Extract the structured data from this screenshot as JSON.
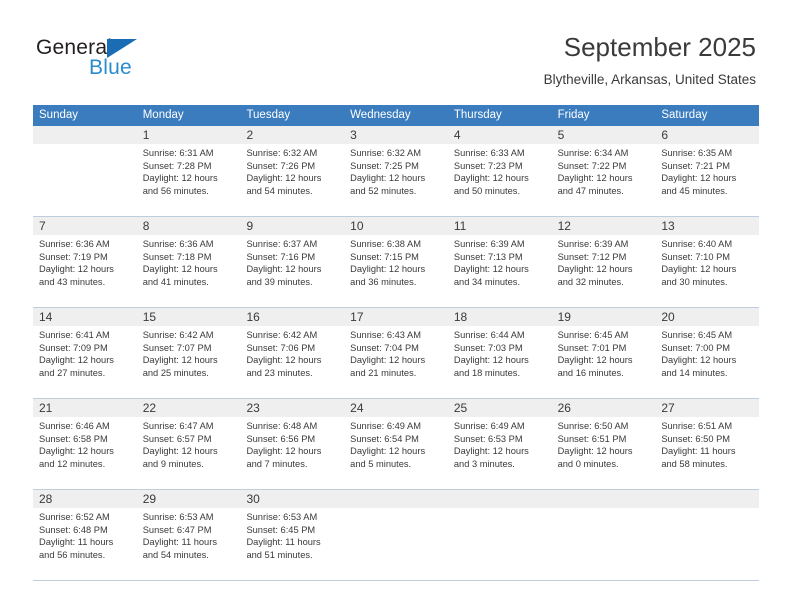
{
  "brand": {
    "name_part1": "General",
    "name_part2": "Blue",
    "triangle_icon": "triangle-icon",
    "colors": {
      "dark": "#231f20",
      "blue": "#2b8ccc",
      "triangle": "#1a6db5"
    }
  },
  "header": {
    "title": "September 2025",
    "subtitle": "Blytheville, Arkansas, United States"
  },
  "theme": {
    "header_row_bg": "#3a7cbe",
    "day_number_band_bg": "#efefef",
    "separator": "#bfcedd",
    "text": "#3a3a3a"
  },
  "weekdays": [
    "Sunday",
    "Monday",
    "Tuesday",
    "Wednesday",
    "Thursday",
    "Friday",
    "Saturday"
  ],
  "weeks": [
    [
      {
        "day": "",
        "sunrise": "",
        "sunset": "",
        "daylight_line1": "",
        "daylight_line2": ""
      },
      {
        "day": "1",
        "sunrise": "Sunrise: 6:31 AM",
        "sunset": "Sunset: 7:28 PM",
        "daylight_line1": "Daylight: 12 hours",
        "daylight_line2": "and 56 minutes."
      },
      {
        "day": "2",
        "sunrise": "Sunrise: 6:32 AM",
        "sunset": "Sunset: 7:26 PM",
        "daylight_line1": "Daylight: 12 hours",
        "daylight_line2": "and 54 minutes."
      },
      {
        "day": "3",
        "sunrise": "Sunrise: 6:32 AM",
        "sunset": "Sunset: 7:25 PM",
        "daylight_line1": "Daylight: 12 hours",
        "daylight_line2": "and 52 minutes."
      },
      {
        "day": "4",
        "sunrise": "Sunrise: 6:33 AM",
        "sunset": "Sunset: 7:23 PM",
        "daylight_line1": "Daylight: 12 hours",
        "daylight_line2": "and 50 minutes."
      },
      {
        "day": "5",
        "sunrise": "Sunrise: 6:34 AM",
        "sunset": "Sunset: 7:22 PM",
        "daylight_line1": "Daylight: 12 hours",
        "daylight_line2": "and 47 minutes."
      },
      {
        "day": "6",
        "sunrise": "Sunrise: 6:35 AM",
        "sunset": "Sunset: 7:21 PM",
        "daylight_line1": "Daylight: 12 hours",
        "daylight_line2": "and 45 minutes."
      }
    ],
    [
      {
        "day": "7",
        "sunrise": "Sunrise: 6:36 AM",
        "sunset": "Sunset: 7:19 PM",
        "daylight_line1": "Daylight: 12 hours",
        "daylight_line2": "and 43 minutes."
      },
      {
        "day": "8",
        "sunrise": "Sunrise: 6:36 AM",
        "sunset": "Sunset: 7:18 PM",
        "daylight_line1": "Daylight: 12 hours",
        "daylight_line2": "and 41 minutes."
      },
      {
        "day": "9",
        "sunrise": "Sunrise: 6:37 AM",
        "sunset": "Sunset: 7:16 PM",
        "daylight_line1": "Daylight: 12 hours",
        "daylight_line2": "and 39 minutes."
      },
      {
        "day": "10",
        "sunrise": "Sunrise: 6:38 AM",
        "sunset": "Sunset: 7:15 PM",
        "daylight_line1": "Daylight: 12 hours",
        "daylight_line2": "and 36 minutes."
      },
      {
        "day": "11",
        "sunrise": "Sunrise: 6:39 AM",
        "sunset": "Sunset: 7:13 PM",
        "daylight_line1": "Daylight: 12 hours",
        "daylight_line2": "and 34 minutes."
      },
      {
        "day": "12",
        "sunrise": "Sunrise: 6:39 AM",
        "sunset": "Sunset: 7:12 PM",
        "daylight_line1": "Daylight: 12 hours",
        "daylight_line2": "and 32 minutes."
      },
      {
        "day": "13",
        "sunrise": "Sunrise: 6:40 AM",
        "sunset": "Sunset: 7:10 PM",
        "daylight_line1": "Daylight: 12 hours",
        "daylight_line2": "and 30 minutes."
      }
    ],
    [
      {
        "day": "14",
        "sunrise": "Sunrise: 6:41 AM",
        "sunset": "Sunset: 7:09 PM",
        "daylight_line1": "Daylight: 12 hours",
        "daylight_line2": "and 27 minutes."
      },
      {
        "day": "15",
        "sunrise": "Sunrise: 6:42 AM",
        "sunset": "Sunset: 7:07 PM",
        "daylight_line1": "Daylight: 12 hours",
        "daylight_line2": "and 25 minutes."
      },
      {
        "day": "16",
        "sunrise": "Sunrise: 6:42 AM",
        "sunset": "Sunset: 7:06 PM",
        "daylight_line1": "Daylight: 12 hours",
        "daylight_line2": "and 23 minutes."
      },
      {
        "day": "17",
        "sunrise": "Sunrise: 6:43 AM",
        "sunset": "Sunset: 7:04 PM",
        "daylight_line1": "Daylight: 12 hours",
        "daylight_line2": "and 21 minutes."
      },
      {
        "day": "18",
        "sunrise": "Sunrise: 6:44 AM",
        "sunset": "Sunset: 7:03 PM",
        "daylight_line1": "Daylight: 12 hours",
        "daylight_line2": "and 18 minutes."
      },
      {
        "day": "19",
        "sunrise": "Sunrise: 6:45 AM",
        "sunset": "Sunset: 7:01 PM",
        "daylight_line1": "Daylight: 12 hours",
        "daylight_line2": "and 16 minutes."
      },
      {
        "day": "20",
        "sunrise": "Sunrise: 6:45 AM",
        "sunset": "Sunset: 7:00 PM",
        "daylight_line1": "Daylight: 12 hours",
        "daylight_line2": "and 14 minutes."
      }
    ],
    [
      {
        "day": "21",
        "sunrise": "Sunrise: 6:46 AM",
        "sunset": "Sunset: 6:58 PM",
        "daylight_line1": "Daylight: 12 hours",
        "daylight_line2": "and 12 minutes."
      },
      {
        "day": "22",
        "sunrise": "Sunrise: 6:47 AM",
        "sunset": "Sunset: 6:57 PM",
        "daylight_line1": "Daylight: 12 hours",
        "daylight_line2": "and 9 minutes."
      },
      {
        "day": "23",
        "sunrise": "Sunrise: 6:48 AM",
        "sunset": "Sunset: 6:56 PM",
        "daylight_line1": "Daylight: 12 hours",
        "daylight_line2": "and 7 minutes."
      },
      {
        "day": "24",
        "sunrise": "Sunrise: 6:49 AM",
        "sunset": "Sunset: 6:54 PM",
        "daylight_line1": "Daylight: 12 hours",
        "daylight_line2": "and 5 minutes."
      },
      {
        "day": "25",
        "sunrise": "Sunrise: 6:49 AM",
        "sunset": "Sunset: 6:53 PM",
        "daylight_line1": "Daylight: 12 hours",
        "daylight_line2": "and 3 minutes."
      },
      {
        "day": "26",
        "sunrise": "Sunrise: 6:50 AM",
        "sunset": "Sunset: 6:51 PM",
        "daylight_line1": "Daylight: 12 hours",
        "daylight_line2": "and 0 minutes."
      },
      {
        "day": "27",
        "sunrise": "Sunrise: 6:51 AM",
        "sunset": "Sunset: 6:50 PM",
        "daylight_line1": "Daylight: 11 hours",
        "daylight_line2": "and 58 minutes."
      }
    ],
    [
      {
        "day": "28",
        "sunrise": "Sunrise: 6:52 AM",
        "sunset": "Sunset: 6:48 PM",
        "daylight_line1": "Daylight: 11 hours",
        "daylight_line2": "and 56 minutes."
      },
      {
        "day": "29",
        "sunrise": "Sunrise: 6:53 AM",
        "sunset": "Sunset: 6:47 PM",
        "daylight_line1": "Daylight: 11 hours",
        "daylight_line2": "and 54 minutes."
      },
      {
        "day": "30",
        "sunrise": "Sunrise: 6:53 AM",
        "sunset": "Sunset: 6:45 PM",
        "daylight_line1": "Daylight: 11 hours",
        "daylight_line2": "and 51 minutes."
      },
      {
        "day": "",
        "sunrise": "",
        "sunset": "",
        "daylight_line1": "",
        "daylight_line2": ""
      },
      {
        "day": "",
        "sunrise": "",
        "sunset": "",
        "daylight_line1": "",
        "daylight_line2": ""
      },
      {
        "day": "",
        "sunrise": "",
        "sunset": "",
        "daylight_line1": "",
        "daylight_line2": ""
      },
      {
        "day": "",
        "sunrise": "",
        "sunset": "",
        "daylight_line1": "",
        "daylight_line2": ""
      }
    ]
  ]
}
